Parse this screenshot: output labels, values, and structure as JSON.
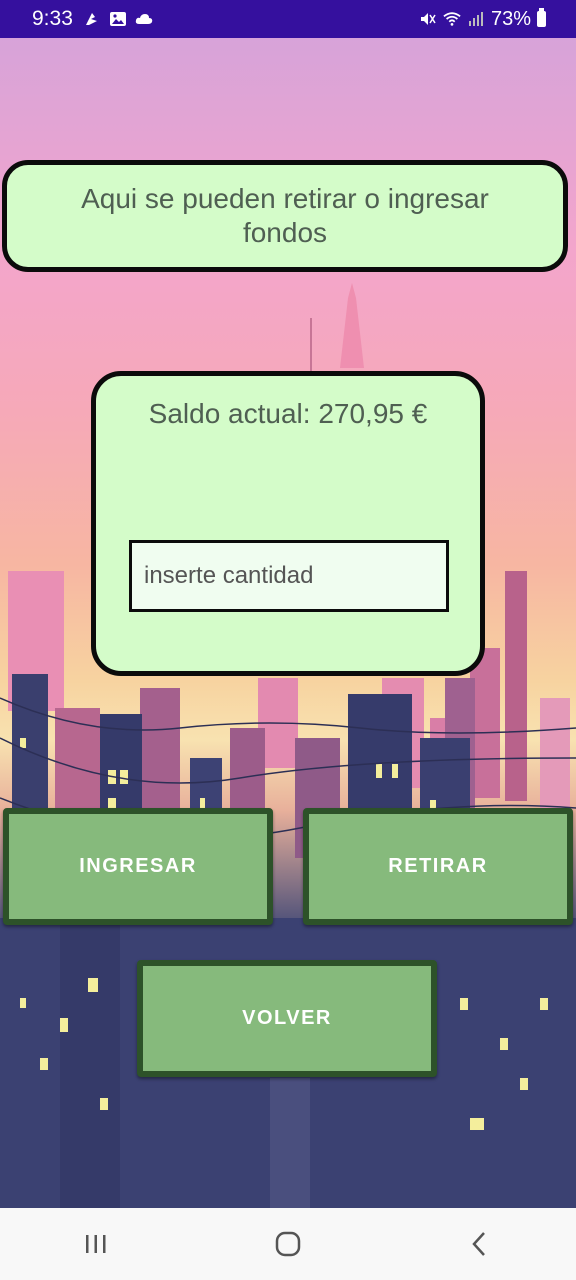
{
  "status_bar": {
    "time": "9:33",
    "battery": "73%",
    "left_icons": [
      "app-notification-icon",
      "image-icon",
      "cloud-icon"
    ],
    "right_icons": [
      "mute-icon",
      "wifi-icon",
      "signal-icon",
      "battery-icon"
    ]
  },
  "info": {
    "text": "Aqui se pueden retirar o ingresar fondos"
  },
  "balance": {
    "text": "Saldo actual: 270,95 €"
  },
  "amount_input": {
    "placeholder": "inserte cantidad",
    "value": ""
  },
  "buttons": {
    "ingresar": "INGRESAR",
    "retirar": "RETIRAR",
    "volver": "VOLVER"
  },
  "navbar": {
    "icons": [
      "recent-apps-icon",
      "home-icon",
      "back-icon"
    ]
  },
  "colors": {
    "card_bg": "#d4fcc9",
    "button_bg": "#86ba7c",
    "button_border": "#2d5229",
    "status_bar": "#35109e"
  }
}
